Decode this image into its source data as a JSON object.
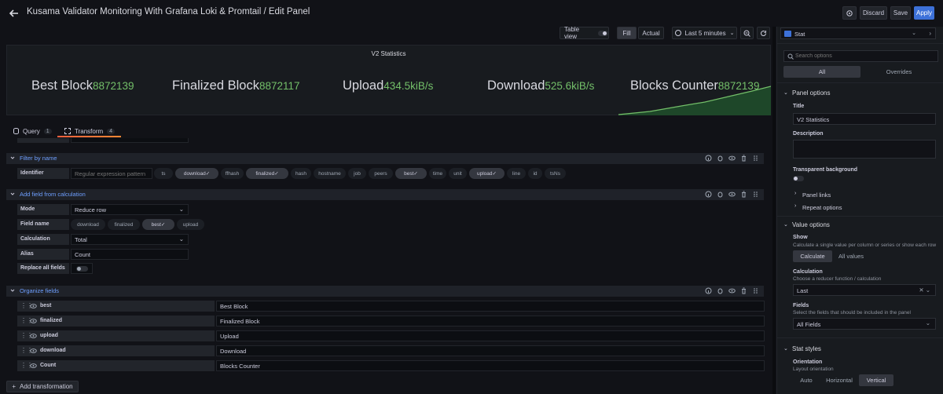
{
  "header": {
    "title": "Kusama Validator Monitoring With Grafana Loki & Promtail / Edit Panel",
    "discard": "Discard",
    "save": "Save",
    "apply": "Apply"
  },
  "toolbar": {
    "table_view": "Table view",
    "fill": "Fill",
    "actual": "Actual",
    "time_range": "Last 5 minutes"
  },
  "panel": {
    "title": "V2 Statistics",
    "stats": [
      {
        "label": "Best Block",
        "value": "8872139"
      },
      {
        "label": "Finalized Block",
        "value": "8872117"
      },
      {
        "label": "Upload",
        "value": "434.5kiB/s"
      },
      {
        "label": "Download",
        "value": "525.6kiB/s"
      },
      {
        "label": "Blocks Counter",
        "value": "8872139"
      }
    ]
  },
  "tabs": {
    "query": {
      "label": "Query",
      "count": "1"
    },
    "transform": {
      "label": "Transform",
      "count": "4"
    }
  },
  "filter_by_name": {
    "title": "Filter by name",
    "identifier_label": "Identifier",
    "identifier_placeholder": "Regular expression pattern",
    "chips": [
      {
        "label": "ts",
        "selected": false
      },
      {
        "label": "download",
        "selected": true
      },
      {
        "label": "ffhash",
        "selected": false
      },
      {
        "label": "finalized",
        "selected": true
      },
      {
        "label": "hash",
        "selected": false
      },
      {
        "label": "hostname",
        "selected": false
      },
      {
        "label": "job",
        "selected": false
      },
      {
        "label": "peers",
        "selected": false
      },
      {
        "label": "best",
        "selected": true
      },
      {
        "label": "time",
        "selected": false
      },
      {
        "label": "unit",
        "selected": false
      },
      {
        "label": "upload",
        "selected": true
      },
      {
        "label": "line",
        "selected": false
      },
      {
        "label": "id",
        "selected": false
      },
      {
        "label": "tsNs",
        "selected": false
      }
    ]
  },
  "add_field": {
    "title": "Add field from calculation",
    "mode_label": "Mode",
    "mode_value": "Reduce row",
    "field_name_label": "Field name",
    "field_chips": [
      {
        "label": "download",
        "selected": false
      },
      {
        "label": "finalized",
        "selected": false
      },
      {
        "label": "best",
        "selected": true
      },
      {
        "label": "upload",
        "selected": false
      }
    ],
    "calculation_label": "Calculation",
    "calculation_value": "Total",
    "alias_label": "Alias",
    "alias_value": "Count",
    "replace_label": "Replace all fields"
  },
  "organize": {
    "title": "Organize fields",
    "rows": [
      {
        "name": "best",
        "rename": "Best Block"
      },
      {
        "name": "finalized",
        "rename": "Finalized Block"
      },
      {
        "name": "upload",
        "rename": "Upload"
      },
      {
        "name": "download",
        "rename": "Download"
      },
      {
        "name": "Count",
        "rename": "Blocks Counter"
      }
    ]
  },
  "add_transformation": "Add transformation",
  "right": {
    "viz_name": "Stat",
    "search_placeholder": "Search options",
    "tab_all": "All",
    "tab_overrides": "Overrides",
    "panel_options": "Panel options",
    "title_label": "Title",
    "title_value": "V2 Statistics",
    "description_label": "Description",
    "transparent_label": "Transparent background",
    "panel_links": "Panel links",
    "repeat_options": "Repeat options",
    "value_options": "Value options",
    "show_label": "Show",
    "show_desc": "Calculate a single value per column or series or show each row",
    "show_calculate": "Calculate",
    "show_all_values": "All values",
    "calculation_label": "Calculation",
    "calculation_desc": "Choose a reducer function / calculation",
    "calculation_value": "Last",
    "fields_label": "Fields",
    "fields_desc": "Select the fields that should be included in the panel",
    "fields_value": "All Fields",
    "stat_styles": "Stat styles",
    "orientation_label": "Orientation",
    "orientation_desc": "Layout orientation",
    "orient_auto": "Auto",
    "orient_horizontal": "Horizontal",
    "orient_vertical": "Vertical"
  },
  "colors": {
    "accent": "#3d71d9",
    "stat_value": "#73bf69",
    "section_title": "#6e9fff"
  }
}
